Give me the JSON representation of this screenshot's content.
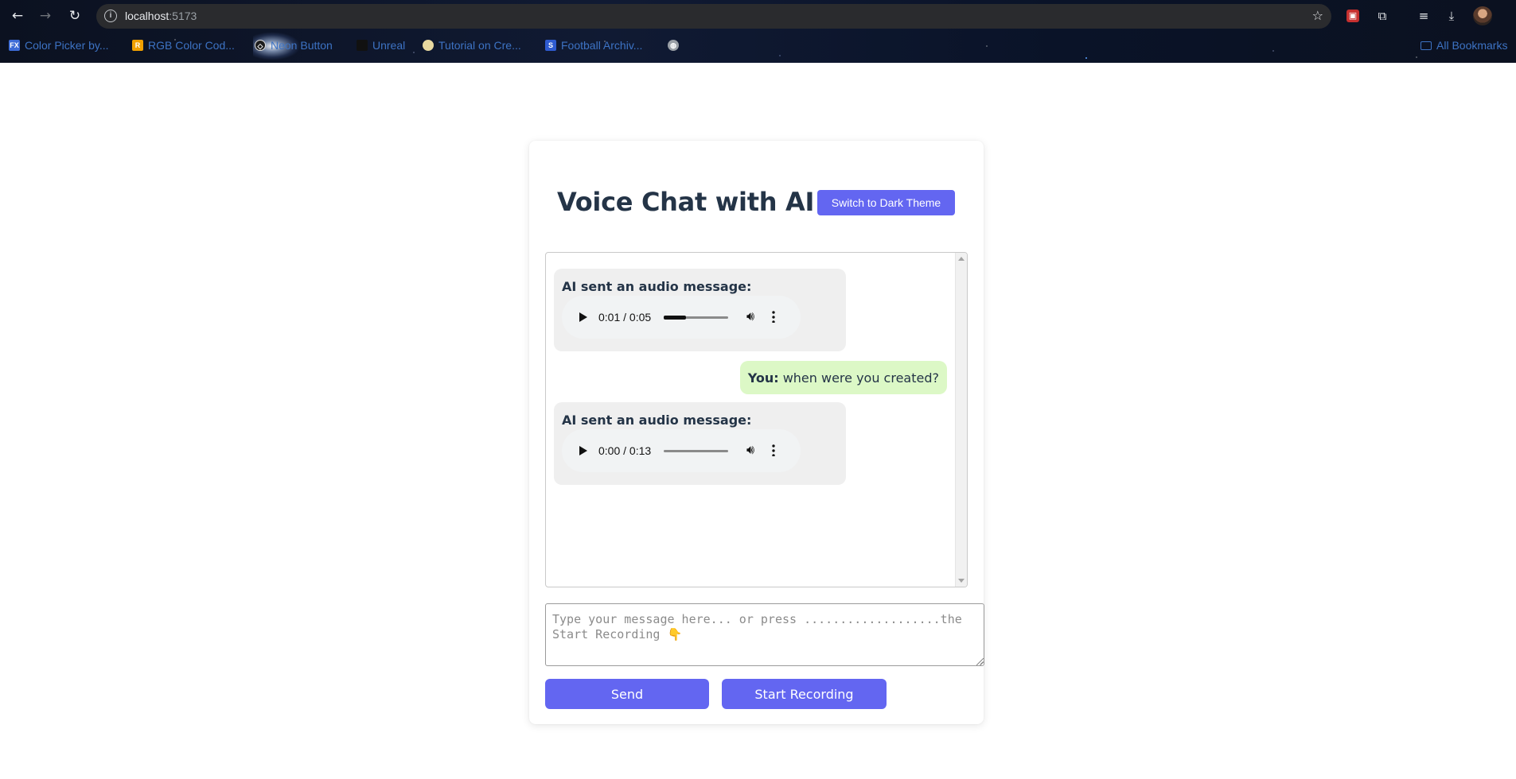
{
  "browser": {
    "url_host": "localhost",
    "url_port": ":5173",
    "bookmarks": [
      {
        "label": "Color Picker by...",
        "icon": "fx-icon",
        "color": "#3c6bd6"
      },
      {
        "label": "RGB Color Cod...",
        "icon": "r-icon",
        "color": "#f0a000"
      },
      {
        "label": "Neon Button",
        "icon": "codepen-icon",
        "color": "#1e1e1e"
      },
      {
        "label": "Unreal",
        "icon": "unreal-icon",
        "color": "#111111"
      },
      {
        "label": "Tutorial on Cre...",
        "icon": "tutorial-icon",
        "color": "#e8d9a0"
      },
      {
        "label": "Football Archiv...",
        "icon": "football-icon",
        "color": "#2f5bd0"
      },
      {
        "label": "",
        "icon": "globe-icon",
        "color": "#9aa0a6"
      }
    ],
    "all_bookmarks": "All Bookmarks"
  },
  "app": {
    "title": "Voice Chat with AI",
    "theme_button": "Switch to Dark Theme",
    "accent": "#6366f1",
    "messages": [
      {
        "from": "ai",
        "label": "AI sent an audio message:",
        "time": "0:01 / 0:05",
        "progress": 0.35
      },
      {
        "from": "user",
        "who": "You:",
        "text": "when were you created?"
      },
      {
        "from": "ai",
        "label": "AI sent an audio message:",
        "time": "0:00 / 0:13",
        "progress": 0.0
      }
    ],
    "input_placeholder": "Type your message here... or press ...................the Start Recording 👇",
    "send_button": "Send",
    "record_button": "Start Recording"
  }
}
